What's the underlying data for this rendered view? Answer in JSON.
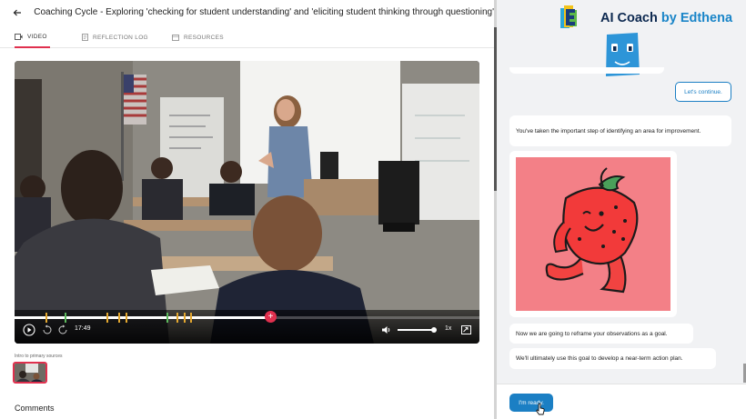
{
  "header": {
    "title": "Coaching Cycle - Exploring 'checking for student understanding' and 'eliciting student thinking through questioning'"
  },
  "tabs": [
    {
      "label": "VIDEO",
      "icon": "video-icon",
      "active": true
    },
    {
      "label": "REFLECTION LOG",
      "icon": "log-icon",
      "active": false
    },
    {
      "label": "RESOURCES",
      "icon": "resources-icon",
      "active": false
    }
  ],
  "player": {
    "time": "17:49",
    "speed": "1x",
    "progress_fraction": 0.55,
    "volume_fraction": 0.95,
    "marker_color_gold": "#e3a72f",
    "marker_color_green": "#5cb85c",
    "scrubber_symbol": "+",
    "scrubber_color": "#e0304e"
  },
  "intro_label": "Intro to primary sources",
  "comments_heading": "Comments",
  "coach": {
    "brand_name": "AI Coach",
    "brand_by": "by Edthena",
    "brand_color": "#0d2950",
    "accent_color": "#1b7fc4",
    "continue_button": "Let's continue.",
    "messages": [
      "You've taken the important step of identifying an area for improvement.",
      "Now we are going to reframe your observations as a goal.",
      "We'll ultimately use this goal to develop a near-term action plan."
    ],
    "ready_button": "I'm ready."
  }
}
